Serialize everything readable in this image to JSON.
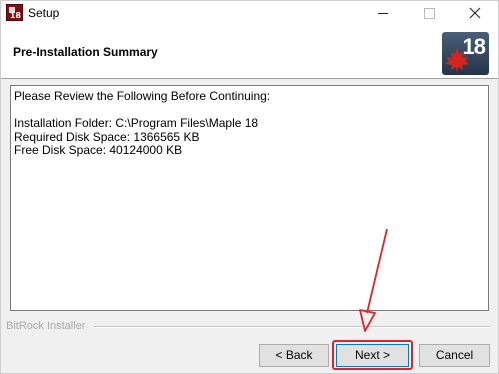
{
  "window": {
    "title": "Setup",
    "app_icon_badge": "18"
  },
  "header": {
    "title": "Pre-Installation Summary",
    "logo_number": "18"
  },
  "summary": {
    "lines": [
      "Please Review the Following Before Continuing:",
      "",
      "Installation Folder: C:\\Program Files\\Maple 18",
      "Required Disk Space: 1366565 KB",
      "Free Disk Space: 40124000 KB"
    ]
  },
  "footer": {
    "brand": "BitRock Installer",
    "back_label": "< Back",
    "next_label": "Next >",
    "cancel_label": "Cancel"
  },
  "annotation": {
    "color": "#e0222a"
  }
}
